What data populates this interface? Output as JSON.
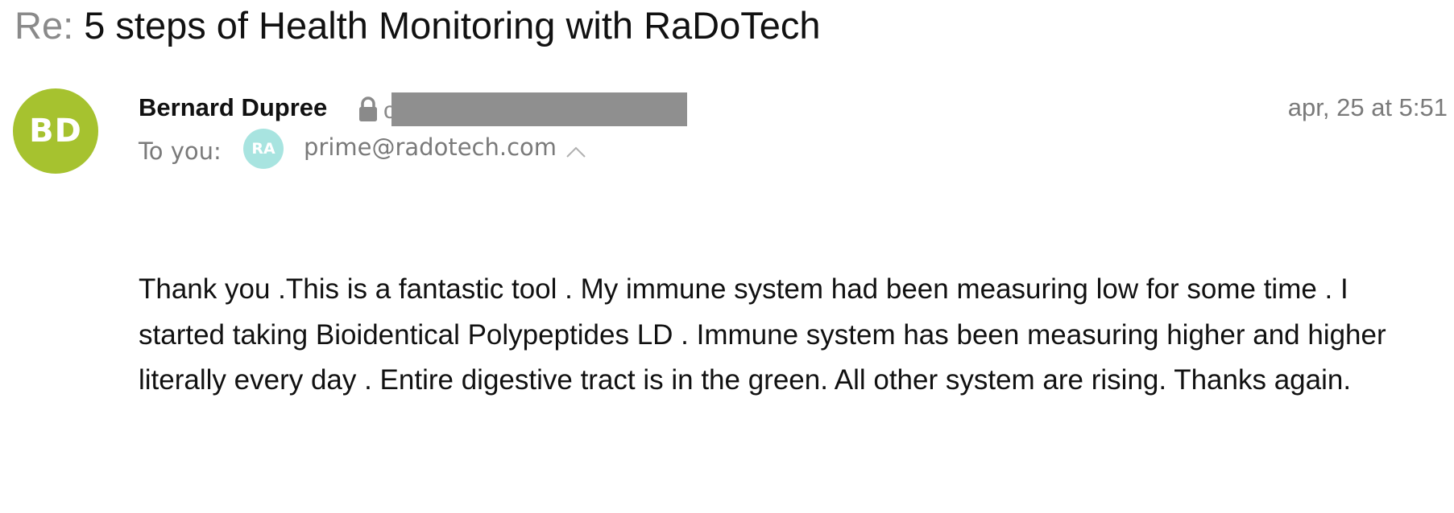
{
  "subject": {
    "prefix": "Re:",
    "title": "5 steps of Health Monitoring with RaDoTech"
  },
  "sender": {
    "initials": "BD",
    "name": "Bernard Dupree",
    "email_visible_fragment": "c",
    "avatar_color": "#a6c22f"
  },
  "date": "apr, 25 at 5:51",
  "recipients": {
    "label": "To you:",
    "items": [
      {
        "initials": "RA",
        "email": "prime@radotech.com",
        "avatar_color": "#a8e4e0"
      }
    ]
  },
  "icons": {
    "lock": "lock-icon",
    "toggle": "chevron-up-icon"
  },
  "message": {
    "body": "Thank you .This is a fantastic tool . My immune system had been measuring low for some time . I started taking Bioidentical Polypeptides LD . Immune system has been measuring higher and higher literally every day . Entire digestive tract is in the green. All other system are rising. Thanks again."
  }
}
